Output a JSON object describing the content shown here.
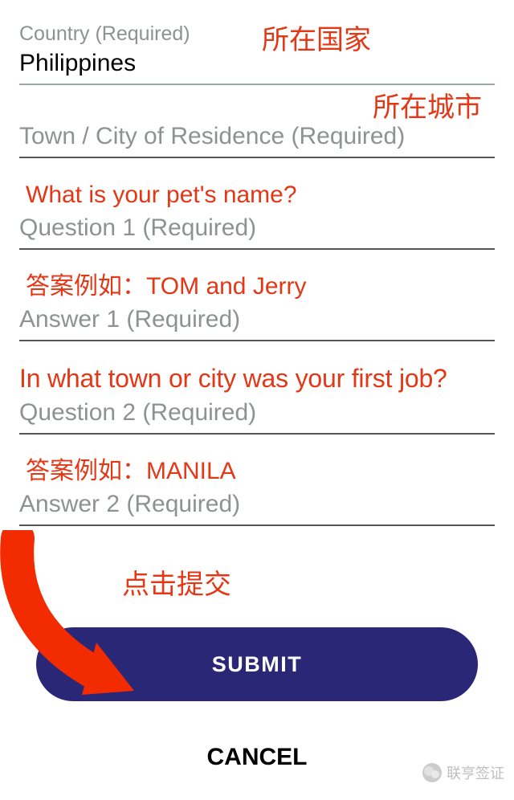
{
  "form": {
    "country": {
      "label": "Country (Required)",
      "value": "Philippines"
    },
    "city": {
      "placeholder": "Town / City of Residence (Required)"
    },
    "q1": {
      "placeholder": "Question 1 (Required)"
    },
    "a1": {
      "placeholder": "Answer 1 (Required)"
    },
    "q2": {
      "placeholder": "Question 2 (Required)"
    },
    "a2": {
      "placeholder": "Answer 2 (Required)"
    }
  },
  "annotations": {
    "country_cn": "所在国家",
    "city_cn": "所在城市",
    "q1_hint": "What is your pet's name?",
    "a1_hint": "答案例如：TOM and Jerry",
    "q2_hint": "In what town or city was your first job?",
    "a2_hint": "答案例如：MANILA",
    "click_submit": "点击提交"
  },
  "buttons": {
    "submit": "SUBMIT",
    "cancel": "CANCEL"
  },
  "watermark": {
    "account": "联亨签证"
  }
}
